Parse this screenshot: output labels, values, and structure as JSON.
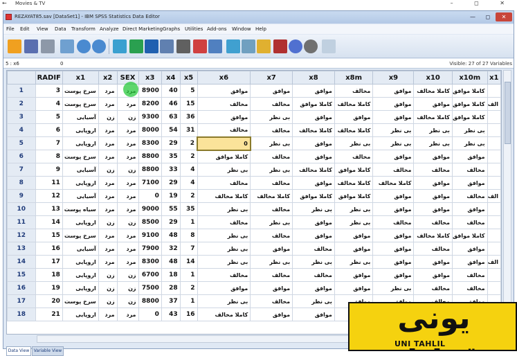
{
  "outer_window": {
    "title": "Movies & TV",
    "back_glyph": "←",
    "controls": "–  ◻  ✕"
  },
  "app": {
    "title": "REZAYAT85.sav [DataSet1] - IBM SPSS Statistics Data Editor",
    "window_buttons": {
      "minimize": "—",
      "maximize": "◻",
      "close": "✕"
    }
  },
  "menu": [
    "File",
    "Edit",
    "View",
    "Data",
    "Transform",
    "Analyze",
    "Direct Marketing",
    "Graphs",
    "Utilities",
    "Add-ons",
    "Window",
    "Help"
  ],
  "toolbar_icons": [
    "open-icon",
    "save-icon",
    "print-icon",
    "dialog-recall-icon",
    "undo-icon",
    "redo-icon",
    "goto-case-icon",
    "goto-variable-icon",
    "variables-icon",
    "run-descriptives-icon",
    "find-icon",
    "insert-cases-icon",
    "insert-variable-icon",
    "split-file-icon",
    "weight-cases-icon",
    "select-cases-icon",
    "value-labels-icon",
    "use-sets-icon",
    "show-all-variables-icon",
    "spell-check-icon"
  ],
  "cell_editor": {
    "reference": "5 : x6",
    "value": "0",
    "visible": "Visible: 27 of 27 Variables"
  },
  "columns": [
    "RADIF",
    "x1",
    "x2",
    "SEX",
    "x3",
    "x4",
    "x5",
    "x6",
    "x7",
    "x8",
    "x8m",
    "x9",
    "x10",
    "x10m",
    "x1"
  ],
  "rows": [
    {
      "n": "1",
      "c": [
        "3",
        "سرخ پوست",
        "مرد",
        "مرد",
        "8900",
        "40",
        "5",
        "موافق",
        "موافق",
        "موافق",
        "مخالف",
        "موافق",
        "کاملا مخالف",
        "کاملا موافق",
        ""
      ]
    },
    {
      "n": "2",
      "c": [
        "4",
        "سرخ پوست",
        "مرد",
        "مرد",
        "8200",
        "46",
        "15",
        "مخالف",
        "مخالف",
        "کاملا موافق",
        "کاملا مخالف",
        "موافق",
        "موافق",
        "کاملا موافق",
        "الف"
      ]
    },
    {
      "n": "3",
      "c": [
        "5",
        "آسیایی",
        "زن",
        "زن",
        "9300",
        "63",
        "36",
        "موافق",
        "بی نظر",
        "موافق",
        "موافق",
        "موافق",
        "کاملا مخالف",
        "کاملا موافق",
        ""
      ]
    },
    {
      "n": "4",
      "c": [
        "6",
        "اروپایی",
        "مرد",
        "مرد",
        "8000",
        "54",
        "31",
        "مخالف",
        "مخالف",
        "کاملا مخالف",
        "کاملا مخالف",
        "بی نظر",
        "بی نظر",
        "بی نظر",
        ""
      ]
    },
    {
      "n": "5",
      "c": [
        "7",
        "اروپایی",
        "مرد",
        "مرد",
        "8300",
        "29",
        "2",
        "0",
        "بی نظر",
        "موافق",
        "بی نظر",
        "بی نظر",
        "بی نظر",
        "بی نظر",
        ""
      ]
    },
    {
      "n": "6",
      "c": [
        "8",
        "سرخ پوست",
        "مرد",
        "مرد",
        "8800",
        "35",
        "2",
        "کاملا موافق",
        "مخالف",
        "موافق",
        "مخالف",
        "موافق",
        "موافق",
        "موافق",
        ""
      ]
    },
    {
      "n": "7",
      "c": [
        "9",
        "آسیایی",
        "زن",
        "زن",
        "8800",
        "33",
        "4",
        "بی نظر",
        "بی نظر",
        "کاملا مخالف",
        "کاملا موافق",
        "مخالف",
        "مخالف",
        "مخالف",
        ""
      ]
    },
    {
      "n": "8",
      "c": [
        "11",
        "اروپایی",
        "مرد",
        "مرد",
        "7100",
        "29",
        "4",
        "مخالف",
        "مخالف",
        "موافق",
        "کاملا مخالف",
        "کاملا مخالف",
        "موافق",
        "موافق",
        ""
      ]
    },
    {
      "n": "9",
      "c": [
        "12",
        "آسیایی",
        "مرد",
        "مرد",
        "0",
        "19",
        "2",
        "کاملا مخالف",
        "کاملا مخالف",
        "کاملا موافق",
        "کاملا موافق",
        "موافق",
        "موافق",
        "مخالف",
        "الف"
      ]
    },
    {
      "n": "10",
      "c": [
        "13",
        "سیاه پوست",
        "مرد",
        "مرد",
        "9000",
        "55",
        "35",
        "بی نظر",
        "مخالف",
        "بی نظر",
        "بی نظر",
        "موافق",
        "موافق",
        "موافق",
        ""
      ]
    },
    {
      "n": "11",
      "c": [
        "14",
        "اروپایی",
        "زن",
        "زن",
        "8500",
        "29",
        "1",
        "مخالف",
        "بی نظر",
        "موافق",
        "بی نظر",
        "مخالف",
        "مخالف",
        "مخالف",
        ""
      ]
    },
    {
      "n": "12",
      "c": [
        "15",
        "سرخ پوست",
        "مرد",
        "مرد",
        "9100",
        "48",
        "8",
        "بی نظر",
        "مخالف",
        "موافق",
        "موافق",
        "موافق",
        "کاملا مخالف",
        "کاملا موافق",
        ""
      ]
    },
    {
      "n": "13",
      "c": [
        "16",
        "آسیایی",
        "مرد",
        "مرد",
        "7900",
        "32",
        "7",
        "بی نظر",
        "موافق",
        "مخالف",
        "موافق",
        "موافق",
        "مخالف",
        "موافق",
        ""
      ]
    },
    {
      "n": "14",
      "c": [
        "17",
        "اروپایی",
        "مرد",
        "مرد",
        "8300",
        "48",
        "14",
        "بی نظر",
        "بی نظر",
        "بی نظر",
        "بی نظر",
        "موافق",
        "موافق",
        "موافق",
        "الف"
      ]
    },
    {
      "n": "15",
      "c": [
        "18",
        "اروپایی",
        "زن",
        "زن",
        "6700",
        "18",
        "1",
        "مخالف",
        "مخالف",
        "مخالف",
        "موافق",
        "موافق",
        "موافق",
        "مخالف",
        ""
      ]
    },
    {
      "n": "16",
      "c": [
        "19",
        "اروپایی",
        "زن",
        "زن",
        "7500",
        "28",
        "2",
        "موافق",
        "موافق",
        "موافق",
        "موافق",
        "بی نظر",
        "مخالف",
        "مخالف",
        ""
      ]
    },
    {
      "n": "17",
      "c": [
        "20",
        "سرخ پوست",
        "زن",
        "زن",
        "8800",
        "37",
        "1",
        "بی نظر",
        "مخالف",
        "بی نظر",
        "موافق",
        "موافق",
        "مخالف",
        "موافق",
        ""
      ]
    },
    {
      "n": "18",
      "c": [
        "21",
        "اروپایی",
        "مرد",
        "مرد",
        "0",
        "43",
        "16",
        "کاملا مخالف",
        "موافق",
        "موافق",
        "",
        "",
        "",
        "",
        ""
      ]
    }
  ],
  "selected_cell": {
    "row": 5,
    "column": "x6"
  },
  "tabs": {
    "data_view": "Data View",
    "variable_view": "Variable View"
  },
  "logo": {
    "arabic": "یونی تحلیل",
    "latin": "UNI TAHLIL"
  },
  "colors": {
    "selected_cell": "#fbe39a",
    "header_bg": "#e4ebf4",
    "row_number": "#1f3b7a",
    "logo_bg": "#f5d20f",
    "cursor_highlight": "#28c83c"
  }
}
